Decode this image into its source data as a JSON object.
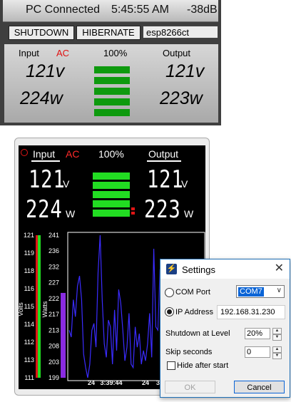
{
  "top_panel": {
    "status": "PC Connected",
    "time": "5:45:55 AM",
    "signal": "-38dB",
    "shutdown_button": "SHUTDOWN",
    "hibernate_button": "HIBERNATE",
    "host": "esp8266ct",
    "readout": {
      "input_label": "Input",
      "ac_label": "AC",
      "percent": "100%",
      "output_label": "Output",
      "input_voltage": "121v",
      "input_watts": "224w",
      "output_voltage": "121v",
      "output_watts": "223w"
    }
  },
  "monitor": {
    "input_label": "Input",
    "ac_label": "AC",
    "percent": "100%",
    "output_label": "Output",
    "input_voltage": "121",
    "input_watts": "224",
    "output_voltage": "121",
    "output_watts": "223",
    "volt_unit": "V",
    "watt_unit": "W",
    "battery_bars": 5,
    "colors": {
      "bar": "#22dd22",
      "alarm": "#e01515",
      "chart_line": "#3b2cff"
    }
  },
  "chart_data": {
    "type": "line",
    "ylabel_left": "Volts",
    "ylabel_right": "Watts",
    "volts_ticks": [
      "121",
      "119",
      "118",
      "116",
      "115",
      "114",
      "112",
      "113",
      "111"
    ],
    "watts_ticks": [
      "241",
      "236",
      "232",
      "227",
      "222",
      "217",
      "213",
      "208",
      "203",
      "199"
    ],
    "volts_ylim": [
      111,
      121
    ],
    "watts_ylim": [
      199,
      241
    ],
    "x_tick_labels": [
      "24",
      "3:39:44",
      "24",
      "3:39:5"
    ],
    "volts_level": 121,
    "watts_level": 224,
    "series": [
      {
        "values": [
          213,
          211,
          222,
          217,
          226,
          229,
          222,
          206,
          202,
          199,
          203,
          213,
          215,
          208,
          230,
          241,
          222,
          209,
          205,
          216,
          214,
          203,
          219,
          207,
          225,
          221,
          213,
          204,
          208,
          218,
          203,
          202,
          214,
          208,
          212,
          203,
          207,
          204,
          209,
          218,
          205,
          237,
          214,
          213,
          231,
          209,
          204,
          203,
          206,
          201,
          211,
          206,
          204,
          210,
          202,
          204,
          207,
          218,
          213,
          205,
          210,
          206,
          210,
          204,
          205,
          200
        ]
      }
    ]
  },
  "dialog": {
    "title": "Settings",
    "com_label": "COM Port",
    "com_value": "COM7",
    "ip_label": "IP Address",
    "ip_value": "192.168.31.230",
    "shutdown_label": "Shutdown at Level",
    "shutdown_value": "20%",
    "skip_label": "Skip seconds",
    "skip_value": "0",
    "hide_label": "Hide after start",
    "ok_label": "OK",
    "cancel_label": "Cancel"
  }
}
